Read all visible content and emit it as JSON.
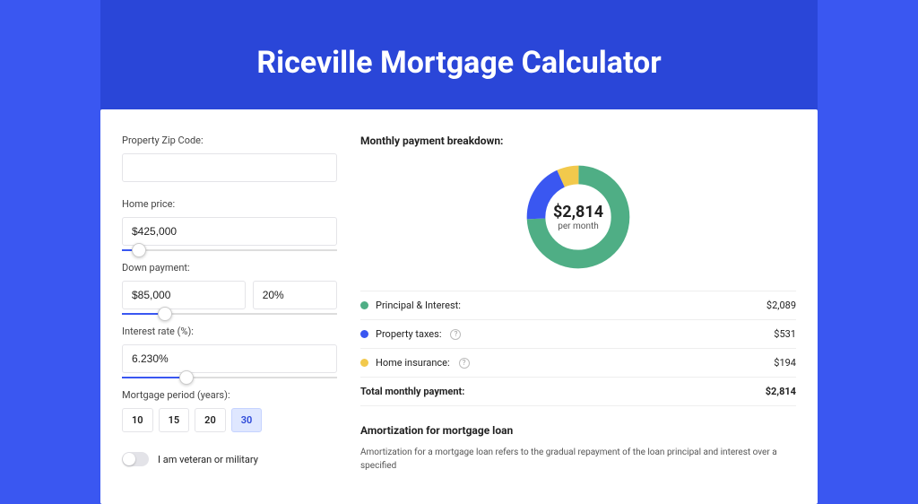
{
  "page": {
    "title": "Riceville Mortgage Calculator"
  },
  "form": {
    "zip_label": "Property Zip Code:",
    "zip_value": "",
    "home_price_label": "Home price:",
    "home_price_value": "$425,000",
    "home_price_slider_pct": 8,
    "down_label": "Down payment:",
    "down_value": "$85,000",
    "down_pct_value": "20%",
    "down_slider_pct": 20,
    "rate_label": "Interest rate (%):",
    "rate_value": "6.230%",
    "rate_slider_pct": 30,
    "period_label": "Mortgage period (years):",
    "period_options": [
      "10",
      "15",
      "20",
      "30"
    ],
    "period_selected": "30",
    "veteran_label": "I am veteran or military",
    "veteran_on": false
  },
  "breakdown": {
    "heading": "Monthly payment breakdown:",
    "donut_total": "$2,814",
    "donut_sub": "per month",
    "rows": [
      {
        "color": "green",
        "label": "Principal & Interest:",
        "info": false,
        "amount": "$2,089"
      },
      {
        "color": "blue",
        "label": "Property taxes:",
        "info": true,
        "amount": "$531"
      },
      {
        "color": "yellow",
        "label": "Home insurance:",
        "info": true,
        "amount": "$194"
      }
    ],
    "total_label": "Total monthly payment:",
    "total_amount": "$2,814"
  },
  "amortization": {
    "title": "Amortization for mortgage loan",
    "body": "Amortization for a mortgage loan refers to the gradual repayment of the loan principal and interest over a specified"
  },
  "chart_data": {
    "type": "pie",
    "title": "Monthly payment breakdown",
    "series": [
      {
        "name": "Principal & Interest",
        "value": 2089,
        "color": "#4fae85"
      },
      {
        "name": "Property taxes",
        "value": 531,
        "color": "#3a57f1"
      },
      {
        "name": "Home insurance",
        "value": 194,
        "color": "#f2c94c"
      }
    ],
    "total": 2814,
    "center_label": "$2,814 per month"
  }
}
